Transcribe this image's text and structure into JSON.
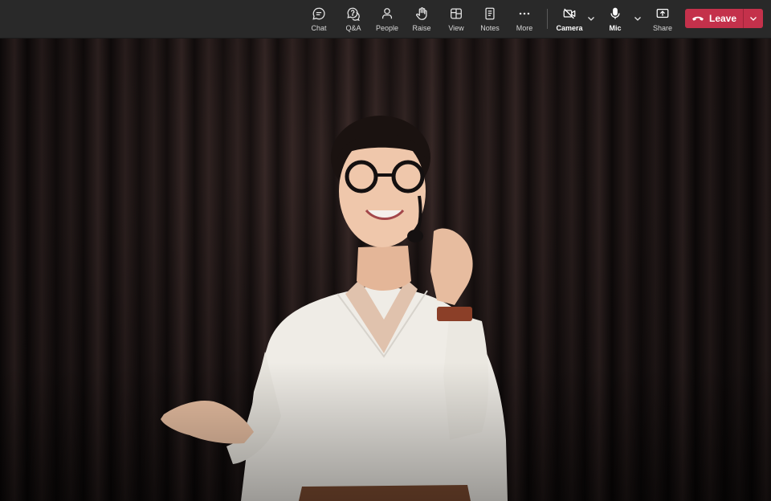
{
  "toolbar": {
    "buttons": [
      {
        "label": "Chat",
        "icon": "chat-icon"
      },
      {
        "label": "Q&A",
        "icon": "qa-icon"
      },
      {
        "label": "People",
        "icon": "people-icon"
      },
      {
        "label": "Raise",
        "icon": "raise-hand-icon"
      },
      {
        "label": "View",
        "icon": "view-icon"
      },
      {
        "label": "Notes",
        "icon": "notes-icon"
      },
      {
        "label": "More",
        "icon": "more-icon"
      },
      {
        "label": "Camera",
        "icon": "camera-off-icon"
      },
      {
        "label": "Mic",
        "icon": "mic-icon"
      },
      {
        "label": "Share",
        "icon": "share-icon"
      }
    ],
    "leave": {
      "label": "Leave",
      "color": "#c4314b"
    }
  },
  "colors": {
    "toolbar_bg": "#292929",
    "leave": "#c4314b"
  }
}
